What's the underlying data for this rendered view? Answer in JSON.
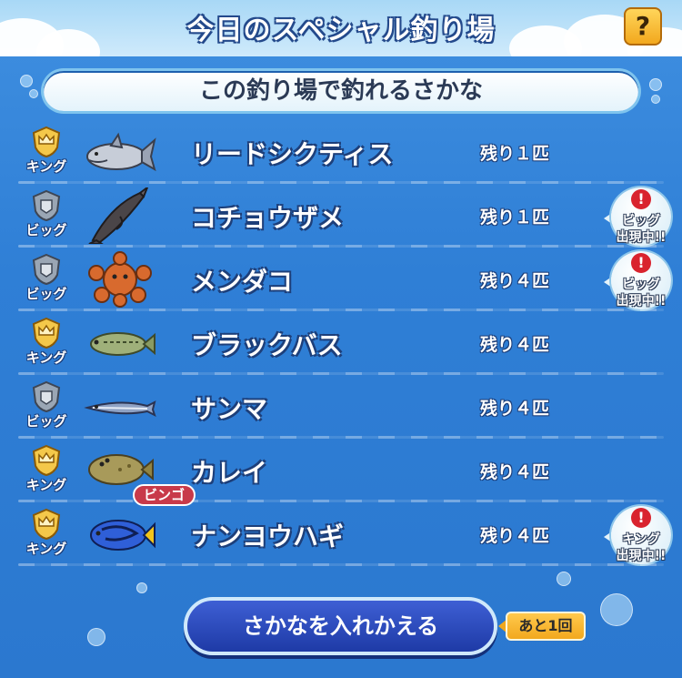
{
  "header": {
    "title": "今日のスペシャル釣り場",
    "help_label": "?"
  },
  "banner": {
    "text": "この釣り場で釣れるさかな"
  },
  "fish_list": [
    {
      "rank": "キング",
      "rank_type": "king",
      "fish_icon": "shark-icon",
      "name": "リードシクティス",
      "remain": "残り１匹",
      "alert": null,
      "bingo": null
    },
    {
      "rank": "ビッグ",
      "rank_type": "big",
      "fish_icon": "sturgeon-icon",
      "name": "コチョウザメ",
      "remain": "残り１匹",
      "alert": {
        "mark": "!",
        "line1": "ビッグ",
        "line2": "出現中!!"
      },
      "bingo": null
    },
    {
      "rank": "ビッグ",
      "rank_type": "big",
      "fish_icon": "octopus-icon",
      "name": "メンダコ",
      "remain": "残り４匹",
      "alert": {
        "mark": "!",
        "line1": "ビッグ",
        "line2": "出現中!!"
      },
      "bingo": null
    },
    {
      "rank": "キング",
      "rank_type": "king",
      "fish_icon": "bass-icon",
      "name": "ブラックバス",
      "remain": "残り４匹",
      "alert": null,
      "bingo": null
    },
    {
      "rank": "ビッグ",
      "rank_type": "big",
      "fish_icon": "saury-icon",
      "name": "サンマ",
      "remain": "残り４匹",
      "alert": null,
      "bingo": null
    },
    {
      "rank": "キング",
      "rank_type": "king",
      "fish_icon": "flounder-icon",
      "name": "カレイ",
      "remain": "残り４匹",
      "alert": null,
      "bingo": "ビンゴ"
    },
    {
      "rank": "キング",
      "rank_type": "king",
      "fish_icon": "blue-tang-icon",
      "name": "ナンヨウハギ",
      "remain": "残り４匹",
      "alert": {
        "mark": "!",
        "line1": "キング",
        "line2": "出現中!!"
      },
      "bingo": null
    }
  ],
  "footer": {
    "swap_label": "さかなを入れかえる",
    "remaining_label": "あと1回"
  },
  "colors": {
    "background": "#2f7fd6",
    "king": "#f4c84a",
    "big": "#9aa6b4",
    "alert": "#d9232e",
    "bingo": "#c83a4a",
    "button": "#1e3aa6",
    "badge": "#f2a81e"
  }
}
